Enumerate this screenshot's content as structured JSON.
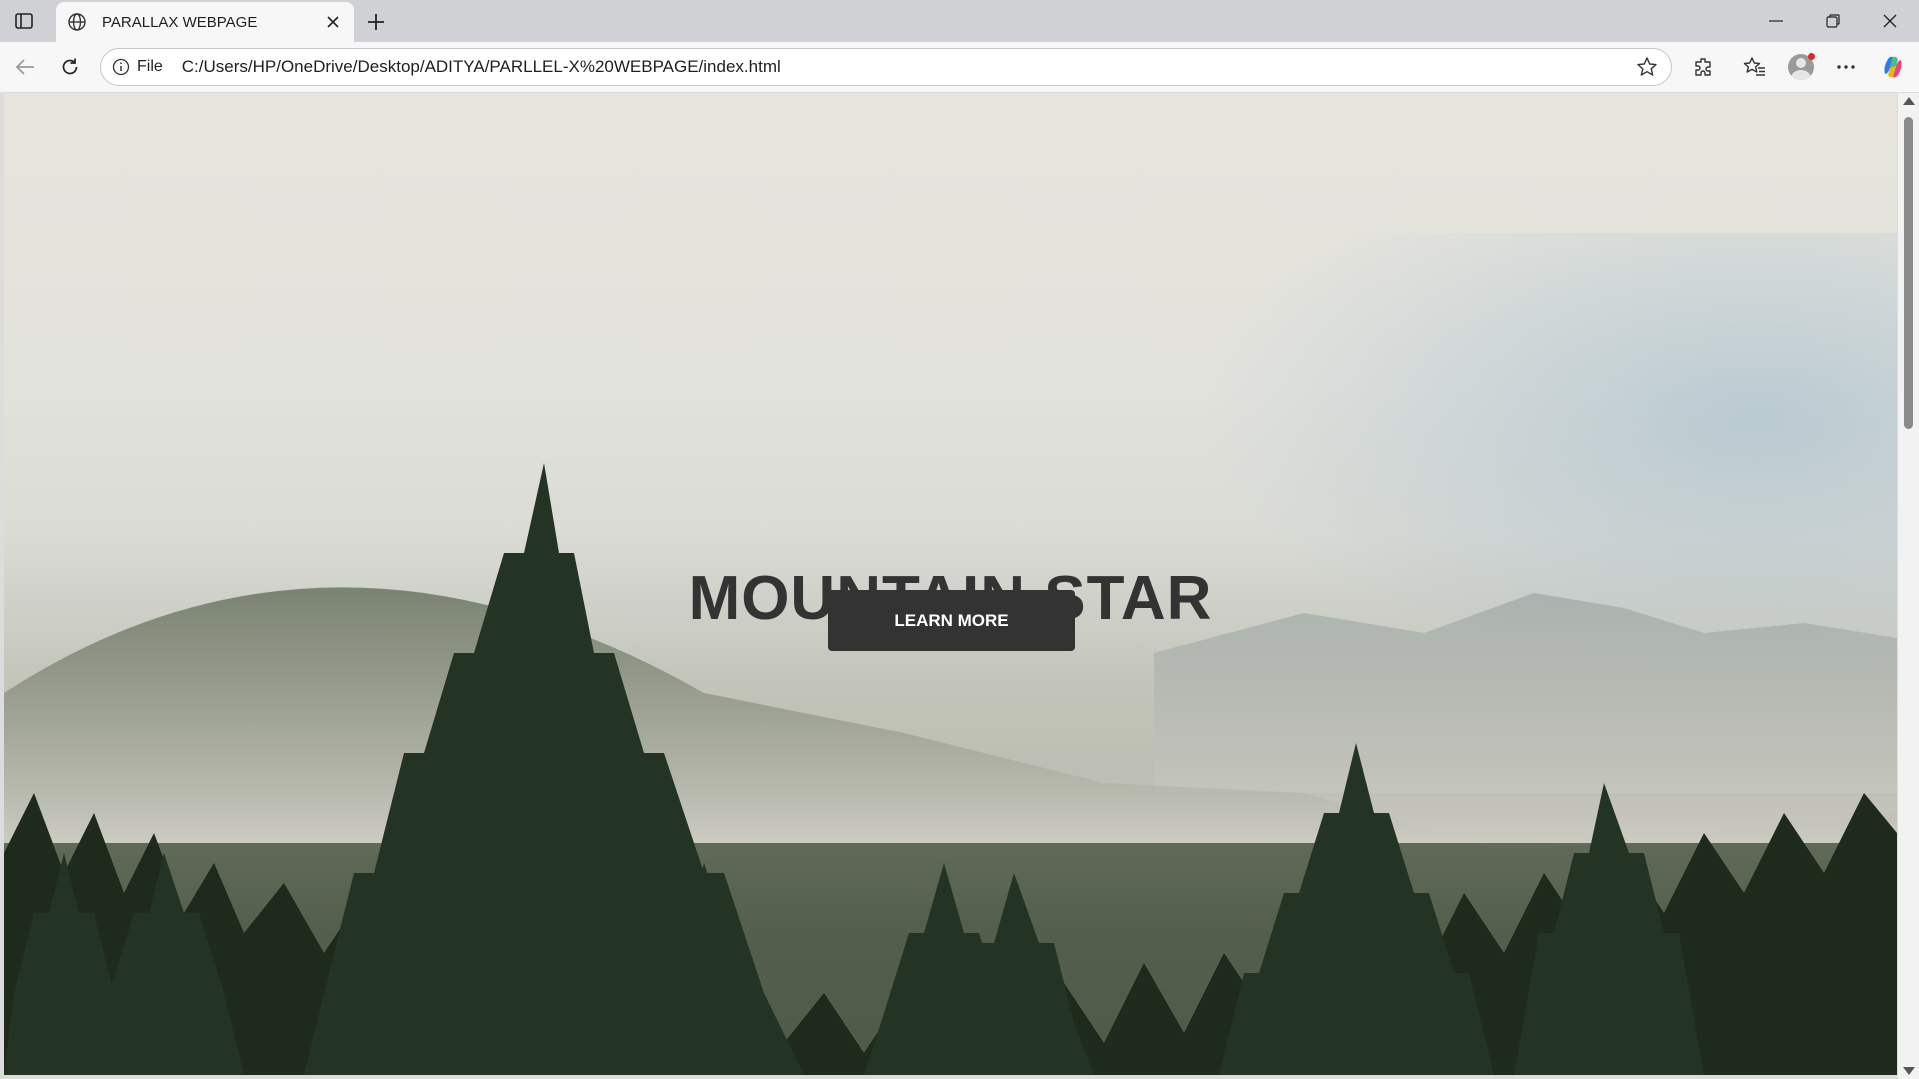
{
  "browser": {
    "tab": {
      "title": "PARALLAX WEBPAGE",
      "favicon": "globe-icon"
    },
    "address": {
      "scheme_label": "File",
      "url": "C:/Users/HP/OneDrive/Desktop/ADITYA/PARLLEL-X%20WEBPAGE/index.html"
    },
    "icons": [
      "sidebar-toggle-icon",
      "globe-icon",
      "close-icon",
      "plus-icon",
      "minimize-icon",
      "restore-icon",
      "window-close-icon",
      "back-arrow-icon",
      "refresh-icon",
      "info-icon",
      "star-icon",
      "extensions-icon",
      "favorites-icon",
      "profile-avatar",
      "more-icon",
      "copilot-icon"
    ]
  },
  "page": {
    "hero_title": "MOUNTAIN STAR",
    "cta_label": "LEARN MORE"
  },
  "colors": {
    "hero_text": "#333333",
    "button_bg": "#333333",
    "button_text": "#ffffff"
  }
}
